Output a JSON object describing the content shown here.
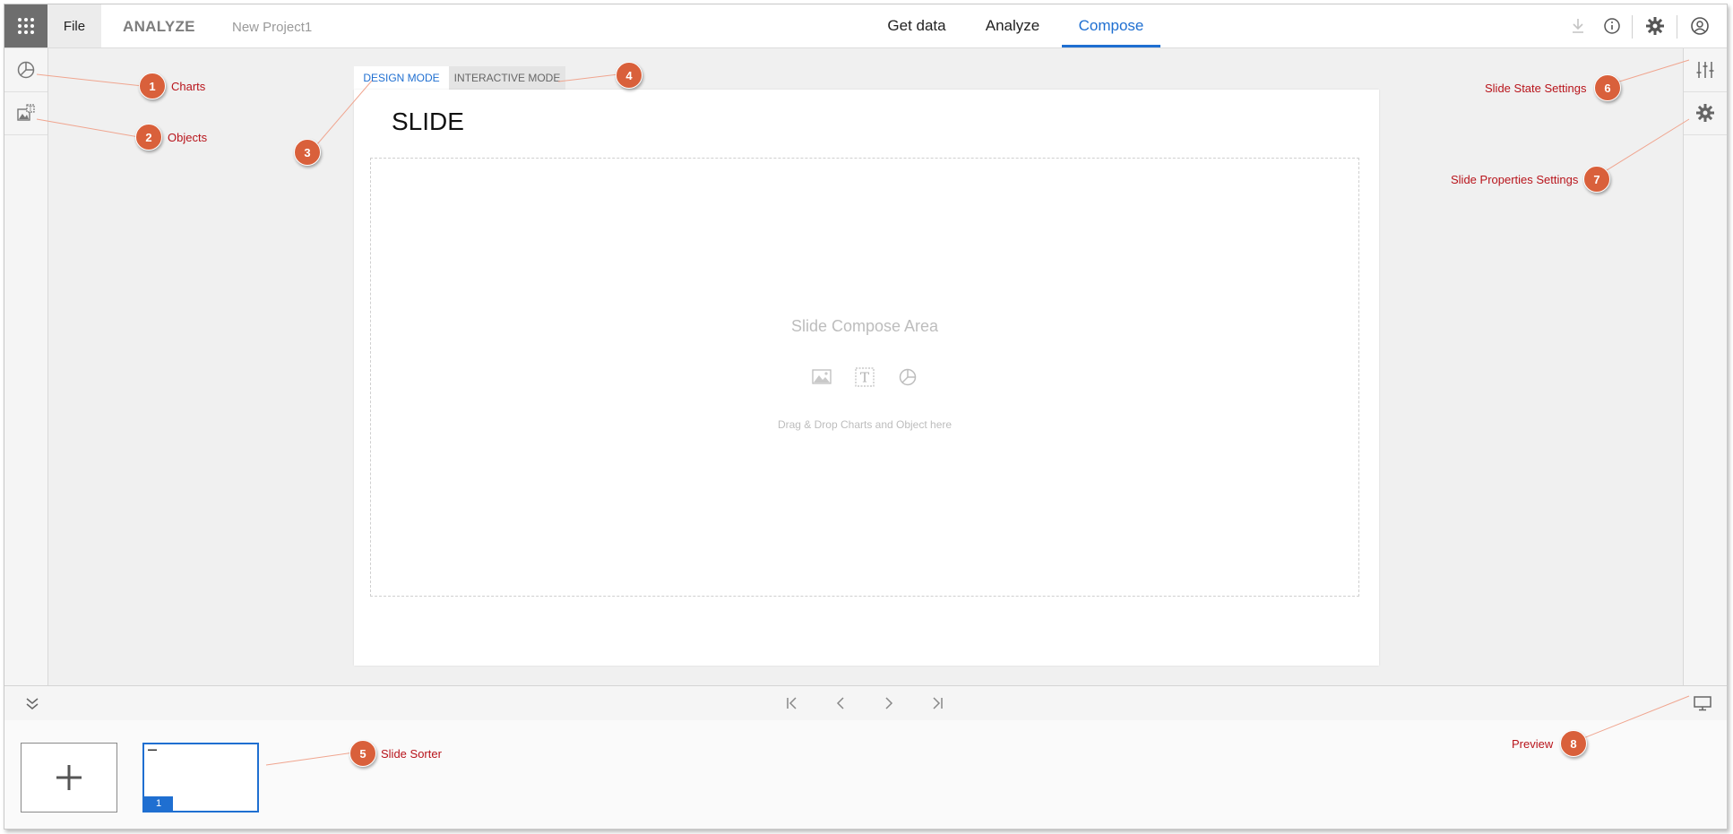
{
  "topbar": {
    "file_label": "File",
    "app_name": "ANALYZE",
    "project_name": "New Project1",
    "tabs": [
      {
        "label": "Get data"
      },
      {
        "label": "Analyze"
      },
      {
        "label": "Compose"
      }
    ],
    "icons": [
      "apps-grid-icon",
      "download-icon",
      "info-icon",
      "gear-icon",
      "user-icon"
    ]
  },
  "left_rail": {
    "items": [
      {
        "icon": "pie-chart-icon"
      },
      {
        "icon": "objects-icon"
      }
    ]
  },
  "right_rail": {
    "items": [
      {
        "icon": "sliders-icon"
      },
      {
        "icon": "gear-icon"
      }
    ]
  },
  "canvas": {
    "mode_tabs": [
      {
        "label": "DESIGN MODE"
      },
      {
        "label": "INTERACTIVE MODE"
      }
    ],
    "slide_title": "SLIDE",
    "compose_area_label": "Slide Compose Area",
    "compose_hint": "Drag & Drop Charts and Object here"
  },
  "pager": {
    "icons": [
      "first-page-icon",
      "prev-page-icon",
      "next-page-icon",
      "last-page-icon"
    ]
  },
  "sorter": {
    "slides": [
      {
        "number": "1"
      }
    ]
  },
  "callouts": [
    {
      "number": "1",
      "label": "Charts"
    },
    {
      "number": "2",
      "label": "Objects"
    },
    {
      "number": "3",
      "label": ""
    },
    {
      "number": "4",
      "label": ""
    },
    {
      "number": "5",
      "label": "Slide Sorter"
    },
    {
      "number": "6",
      "label": "Slide State Settings"
    },
    {
      "number": "7",
      "label": "Slide Properties Settings"
    },
    {
      "number": "8",
      "label": "Preview"
    }
  ],
  "colors": {
    "accent": "#1f6fd1",
    "callout": "#d9603b",
    "callout_text": "#b8141b"
  }
}
